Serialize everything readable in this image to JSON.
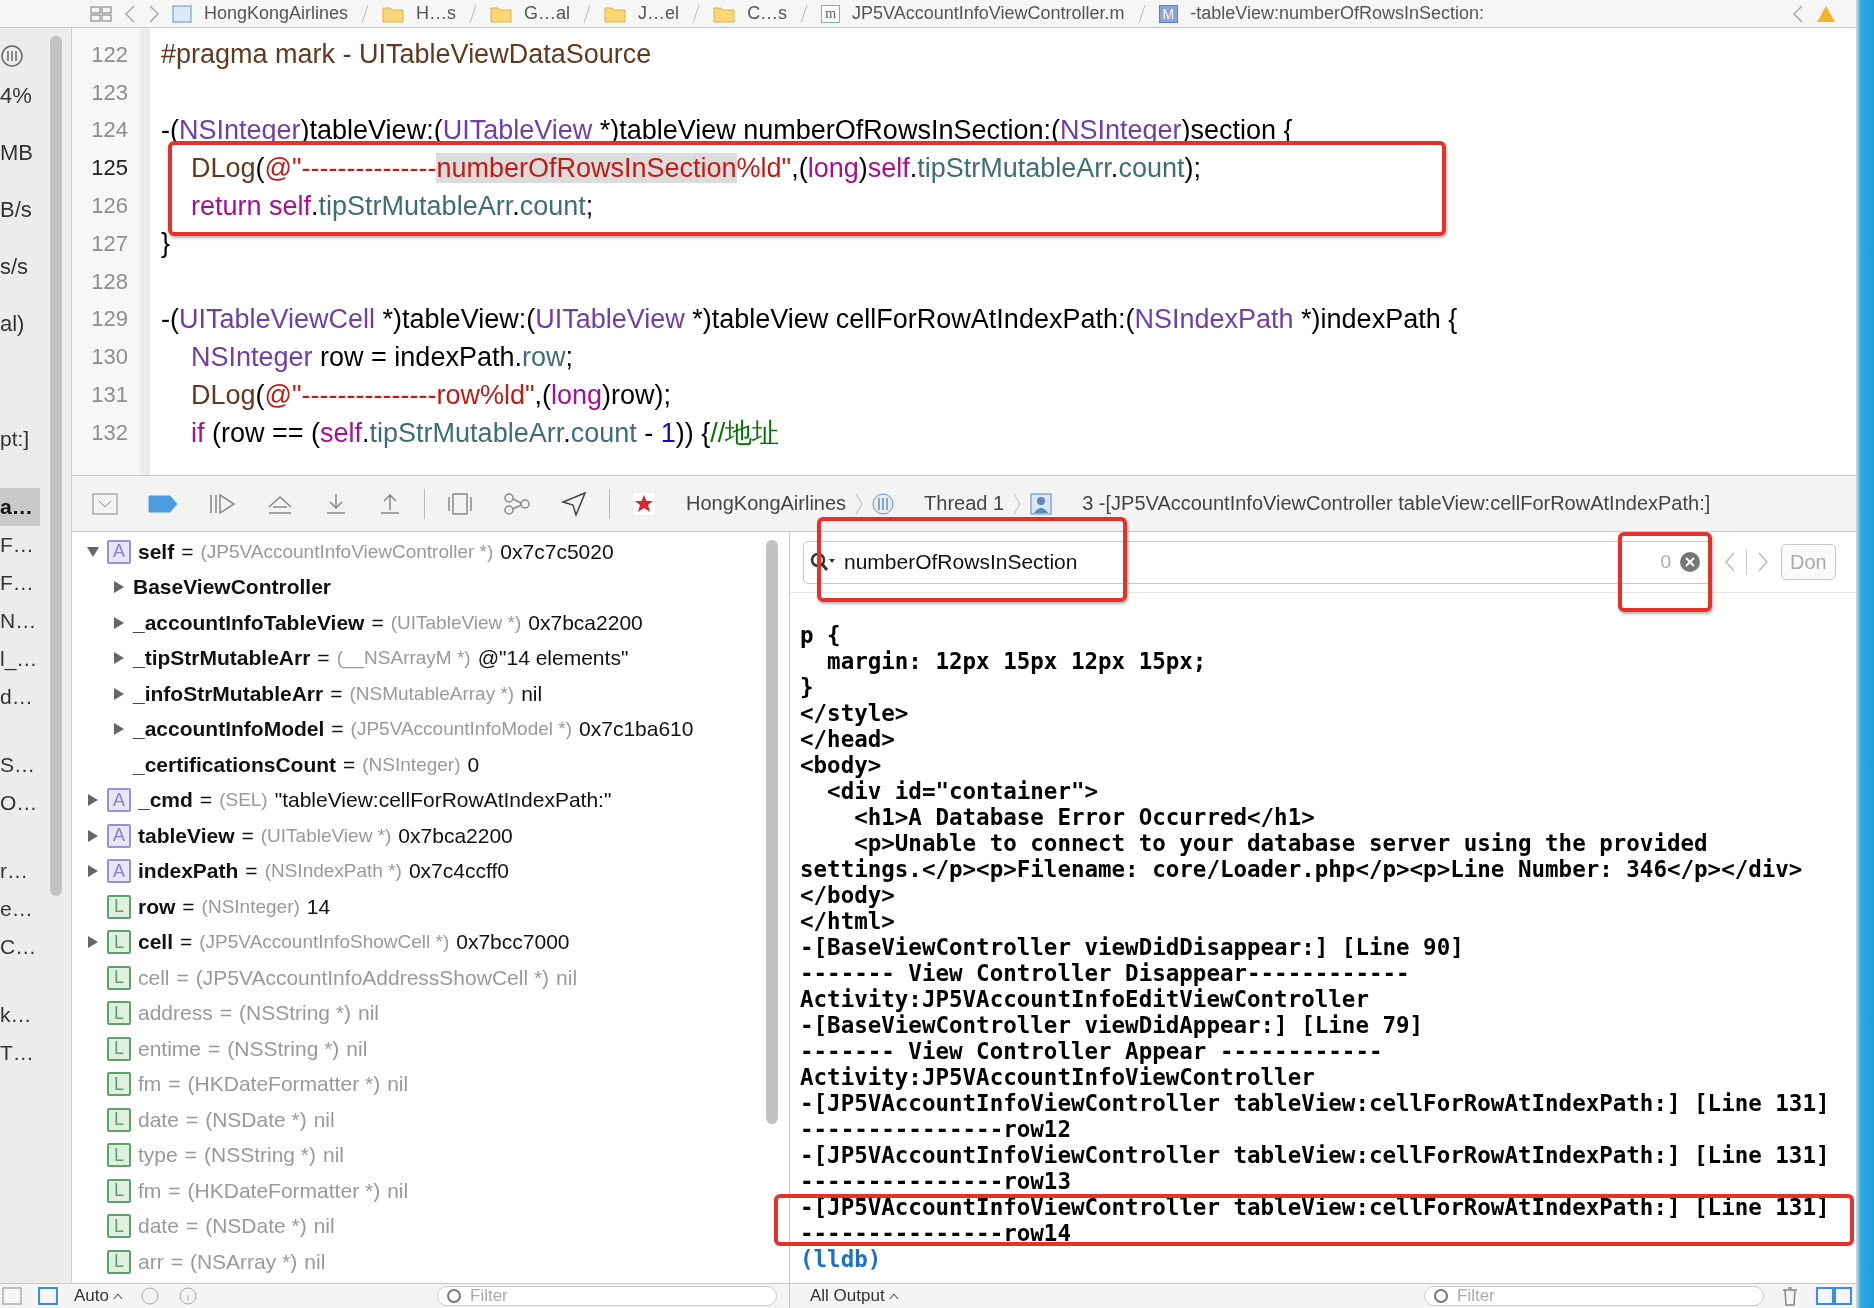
{
  "jump_bar": {
    "items": [
      {
        "kind": "project",
        "label": "HongKongAirlines"
      },
      {
        "kind": "folder",
        "label": "H…s"
      },
      {
        "kind": "folder",
        "label": "G…al"
      },
      {
        "kind": "folder",
        "label": "J…el"
      },
      {
        "kind": "folder",
        "label": "C…s"
      },
      {
        "kind": "source",
        "badge": "m",
        "label": "JP5VAccountInfoViewController.m"
      },
      {
        "kind": "method",
        "badge": "M",
        "label": "-tableView:numberOfRowsInSection:"
      }
    ]
  },
  "debug_navigator": {
    "gauges": [
      "4%",
      "MB",
      "B/s",
      "s/s",
      "al)"
    ],
    "threads": [
      {
        "frames": [
          {
            "label": "pt:]",
            "selected": false
          }
        ]
      },
      {
        "frames": [
          {
            "label": "a…",
            "selected": true
          },
          {
            "label": "F…",
            "selected": false
          },
          {
            "label": "F…",
            "selected": false
          },
          {
            "label": "N…",
            "selected": false
          },
          {
            "label": "l_…",
            "selected": false
          },
          {
            "label": "d…",
            "selected": false
          }
        ]
      },
      {
        "frames": [
          {
            "label": "S…",
            "selected": false
          },
          {
            "label": "O…",
            "selected": false
          }
        ]
      },
      {
        "frames": [
          {
            "label": "r…",
            "selected": false
          },
          {
            "label": "e…",
            "selected": false
          },
          {
            "label": "C…",
            "selected": false
          }
        ]
      },
      {
        "frames": [
          {
            "label": "k…",
            "selected": false
          },
          {
            "label": "T…",
            "selected": false
          }
        ]
      }
    ]
  },
  "editor": {
    "lines": [
      {
        "number": "122",
        "current": false,
        "tokens": [
          {
            "kind": "macro",
            "text": "#pragma mark - UITableViewDataSource"
          }
        ]
      },
      {
        "number": "123",
        "current": false
      },
      {
        "number": "124",
        "current": false,
        "tokens": [
          {
            "kind": "plain",
            "text": "-("
          },
          {
            "kind": "type",
            "text": "NSInteger"
          },
          {
            "kind": "plain",
            "text": ")tableView:("
          },
          {
            "kind": "type",
            "text": "UITableView"
          },
          {
            "kind": "plain",
            "text": " *)tableView numberOfRowsInSection:("
          },
          {
            "kind": "type",
            "text": "NSInteger"
          },
          {
            "kind": "plain",
            "text": ")section {"
          }
        ]
      },
      {
        "number": "125",
        "current": true,
        "tokens": [
          {
            "kind": "macro",
            "text": "    DLog"
          },
          {
            "kind": "plain",
            "text": "("
          },
          {
            "kind": "string",
            "text": "@\"---------------"
          },
          {
            "kind": "string_match",
            "text": "numberOfRowsInSection"
          },
          {
            "kind": "string",
            "text": "%ld\""
          },
          {
            "kind": "plain",
            "text": ",("
          },
          {
            "kind": "keyword",
            "text": "long"
          },
          {
            "kind": "plain",
            "text": ")"
          },
          {
            "kind": "keyword",
            "text": "self"
          },
          {
            "kind": "plain",
            "text": "."
          },
          {
            "kind": "prop",
            "text": "tipStrMutableArr"
          },
          {
            "kind": "plain",
            "text": "."
          },
          {
            "kind": "prop",
            "text": "count"
          },
          {
            "kind": "plain",
            "text": ");"
          }
        ]
      },
      {
        "number": "126",
        "current": false,
        "tokens": [
          {
            "kind": "keyword",
            "text": "    return self"
          },
          {
            "kind": "plain",
            "text": "."
          },
          {
            "kind": "prop",
            "text": "tipStrMutableArr"
          },
          {
            "kind": "plain",
            "text": "."
          },
          {
            "kind": "prop",
            "text": "count"
          },
          {
            "kind": "plain",
            "text": ";"
          }
        ]
      },
      {
        "number": "127",
        "current": false,
        "tokens": [
          {
            "kind": "plain",
            "text": "}"
          }
        ]
      },
      {
        "number": "128",
        "current": false
      },
      {
        "number": "129",
        "current": false,
        "tokens": [
          {
            "kind": "plain",
            "text": "-("
          },
          {
            "kind": "type",
            "text": "UITableViewCell"
          },
          {
            "kind": "plain",
            "text": " *)tableView:("
          },
          {
            "kind": "type",
            "text": "UITableView"
          },
          {
            "kind": "plain",
            "text": " *)tableView cellForRowAtIndexPath:("
          },
          {
            "kind": "type",
            "text": "NSIndexPath"
          },
          {
            "kind": "plain",
            "text": " *)indexPath {"
          }
        ]
      },
      {
        "number": "130",
        "current": false,
        "tokens": [
          {
            "kind": "type",
            "text": "    NSInteger"
          },
          {
            "kind": "plain",
            "text": " row = indexPath."
          },
          {
            "kind": "prop",
            "text": "row"
          },
          {
            "kind": "plain",
            "text": ";"
          }
        ]
      },
      {
        "number": "131",
        "current": false,
        "tokens": [
          {
            "kind": "macro",
            "text": "    DLog"
          },
          {
            "kind": "plain",
            "text": "("
          },
          {
            "kind": "string",
            "text": "@\"---------------row%ld\""
          },
          {
            "kind": "plain",
            "text": ",("
          },
          {
            "kind": "keyword",
            "text": "long"
          },
          {
            "kind": "plain",
            "text": ")row);"
          }
        ]
      },
      {
        "number": "132",
        "current": false,
        "tokens": [
          {
            "kind": "keyword",
            "text": "    if"
          },
          {
            "kind": "plain",
            "text": " (row == ("
          },
          {
            "kind": "keyword",
            "text": "self"
          },
          {
            "kind": "plain",
            "text": "."
          },
          {
            "kind": "prop",
            "text": "tipStrMutableArr"
          },
          {
            "kind": "plain",
            "text": "."
          },
          {
            "kind": "prop",
            "text": "count"
          },
          {
            "kind": "plain",
            "text": " - "
          },
          {
            "kind": "number",
            "text": "1"
          },
          {
            "kind": "plain",
            "text": ")) {"
          },
          {
            "kind": "comment",
            "text": "//地址"
          }
        ]
      }
    ]
  },
  "debug_bar": {
    "breakpoints_active": true,
    "breadcrumb": [
      {
        "kind": "app",
        "label": "HongKongAirlines"
      },
      {
        "kind": "thread",
        "label": "Thread 1"
      },
      {
        "kind": "frame",
        "label": "3 -[JP5VAccountInfoViewController tableView:cellForRowAtIndexPath:]"
      }
    ]
  },
  "variables": [
    {
      "expanded": true,
      "kind": "argument",
      "badge": "A",
      "dimmed": false,
      "name": "self",
      "op": "=",
      "type": "(JP5VAccountInfoViewController *)",
      "value": "0x7c7c5020",
      "children": [
        {
          "expanded": false,
          "dimmed": false,
          "name": "BaseViewController"
        },
        {
          "expanded": false,
          "dimmed": false,
          "name": "_accountInfoTableView",
          "op": "=",
          "type": "(UITableView *)",
          "value": "0x7bca2200"
        },
        {
          "expanded": false,
          "dimmed": false,
          "name": "_tipStrMutableArr",
          "op": "=",
          "type": "(__NSArrayM *)",
          "value": "@\"14 elements\""
        },
        {
          "expanded": false,
          "dimmed": false,
          "name": "_infoStrMutableArr",
          "op": "=",
          "type": "(NSMutableArray *)",
          "value": "nil"
        },
        {
          "expanded": false,
          "dimmed": false,
          "name": "_accountInfoModel",
          "op": "=",
          "type": "(JP5VAccountInfoModel *)",
          "value": "0x7c1ba610"
        },
        {
          "dimmed": false,
          "name": "_certificationsCount",
          "op": "=",
          "type": "(NSInteger)",
          "value": "0"
        }
      ]
    },
    {
      "expanded": false,
      "kind": "argument",
      "badge": "A",
      "dimmed": false,
      "name": "_cmd",
      "op": "=",
      "type": "(SEL)",
      "value": "\"tableView:cellForRowAtIndexPath:\""
    },
    {
      "expanded": false,
      "kind": "argument",
      "badge": "A",
      "dimmed": false,
      "name": "tableView",
      "op": "=",
      "type": "(UITableView *)",
      "value": "0x7bca2200"
    },
    {
      "expanded": false,
      "kind": "argument",
      "badge": "A",
      "dimmed": false,
      "name": "indexPath",
      "op": "=",
      "type": "(NSIndexPath *)",
      "value": "0x7c4ccff0"
    },
    {
      "kind": "local",
      "badge": "L",
      "dimmed": false,
      "name": "row",
      "op": "=",
      "type": "(NSInteger)",
      "value": "14"
    },
    {
      "expanded": false,
      "kind": "local",
      "badge": "L",
      "dimmed": false,
      "name": "cell",
      "op": "=",
      "type": "(JP5VAccountInfoShowCell *)",
      "value": "0x7bcc7000"
    },
    {
      "kind": "local",
      "badge": "L",
      "dimmed": true,
      "name": "cell",
      "op": "=",
      "type": "(JP5VAccountInfoAddressShowCell *)",
      "value": "nil"
    },
    {
      "kind": "local",
      "badge": "L",
      "dimmed": true,
      "name": "address",
      "op": "=",
      "type": "(NSString *)",
      "value": "nil"
    },
    {
      "kind": "local",
      "badge": "L",
      "dimmed": true,
      "name": "entime",
      "op": "=",
      "type": "(NSString *)",
      "value": "nil"
    },
    {
      "kind": "local",
      "badge": "L",
      "dimmed": true,
      "name": "fm",
      "op": "=",
      "type": "(HKDateFormatter *)",
      "value": "nil"
    },
    {
      "kind": "local",
      "badge": "L",
      "dimmed": true,
      "name": "date",
      "op": "=",
      "type": "(NSDate *)",
      "value": "nil"
    },
    {
      "kind": "local",
      "badge": "L",
      "dimmed": true,
      "name": "type",
      "op": "=",
      "type": "(NSString *)",
      "value": "nil"
    },
    {
      "kind": "local",
      "badge": "L",
      "dimmed": true,
      "name": "fm",
      "op": "=",
      "type": "(HKDateFormatter *)",
      "value": "nil"
    },
    {
      "kind": "local",
      "badge": "L",
      "dimmed": true,
      "name": "date",
      "op": "=",
      "type": "(NSDate *)",
      "value": "nil"
    },
    {
      "kind": "local",
      "badge": "L",
      "dimmed": true,
      "name": "arr",
      "op": "=",
      "type": "(NSArray *)",
      "value": "nil"
    }
  ],
  "console": {
    "search": {
      "value": "numberOfRowsInSection",
      "count": "0",
      "done": "Don"
    },
    "lines": [
      {
        "kind": "output",
        "text": "p {"
      },
      {
        "kind": "output",
        "text": "  margin: 12px 15px 12px 15px;"
      },
      {
        "kind": "output",
        "text": "}"
      },
      {
        "kind": "output",
        "text": "</style>"
      },
      {
        "kind": "output",
        "text": "</head>"
      },
      {
        "kind": "output",
        "text": "<body>"
      },
      {
        "kind": "output",
        "text": "  <div id=\"container\">"
      },
      {
        "kind": "output",
        "text": "    <h1>A Database Error Occurred</h1>"
      },
      {
        "kind": "output",
        "text": "    <p>Unable to connect to your database server using the provided"
      },
      {
        "kind": "output",
        "text": "settings.</p><p>Filename: core/Loader.php</p><p>Line Number: 346</p></div>"
      },
      {
        "kind": "output",
        "text": "</body>"
      },
      {
        "kind": "output",
        "text": "</html>"
      },
      {
        "kind": "output",
        "text": "-[BaseViewController viewDidDisappear:] [Line 90]"
      },
      {
        "kind": "output",
        "text": "------- View Controller Disappear------------"
      },
      {
        "kind": "output",
        "text": "Activity:JP5VAccountInfoEditViewController"
      },
      {
        "kind": "output",
        "text": "-[BaseViewController viewDidAppear:] [Line 79]"
      },
      {
        "kind": "output",
        "text": "------- View Controller Appear ------------"
      },
      {
        "kind": "output",
        "text": "Activity:JP5VAccountInfoViewController"
      },
      {
        "kind": "output",
        "text": "-[JP5VAccountInfoViewController tableView:cellForRowAtIndexPath:] [Line 131]"
      },
      {
        "kind": "output",
        "text": "---------------row12"
      },
      {
        "kind": "output",
        "text": "-[JP5VAccountInfoViewController tableView:cellForRowAtIndexPath:] [Line 131]"
      },
      {
        "kind": "output",
        "text": "---------------row13"
      },
      {
        "kind": "output",
        "text": "-[JP5VAccountInfoViewController tableView:cellForRowAtIndexPath:] [Line 131]"
      },
      {
        "kind": "output",
        "text": "---------------row14"
      },
      {
        "kind": "prompt",
        "text": "(lldb)"
      }
    ]
  },
  "bottom_bar": {
    "variables": {
      "scope": "Auto",
      "filter_placeholder": "Filter"
    },
    "console": {
      "output": "All Output",
      "filter_placeholder": "Filter"
    }
  }
}
